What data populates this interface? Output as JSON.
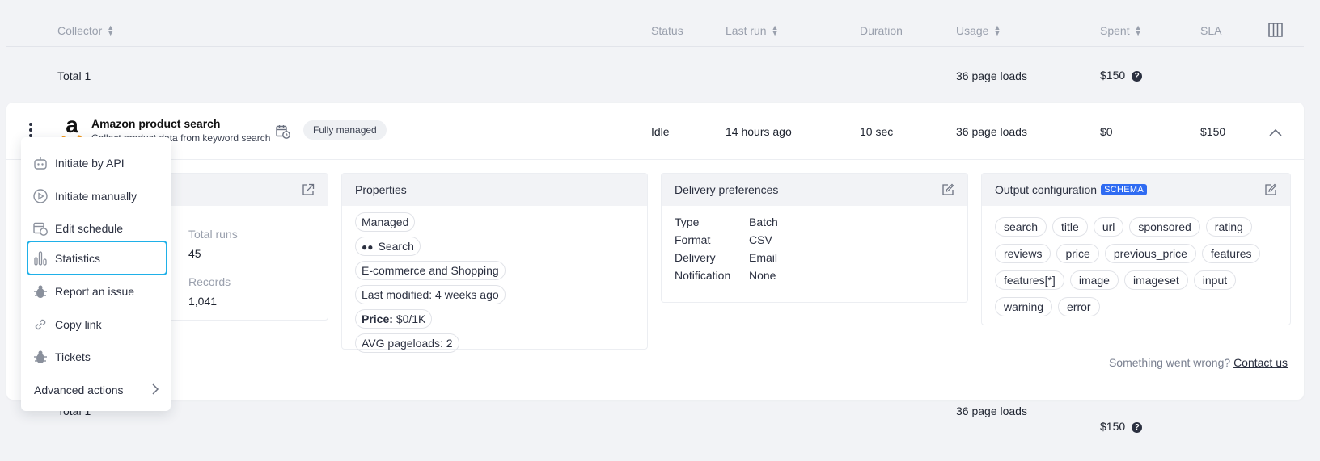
{
  "table": {
    "headers": {
      "collector": "Collector",
      "status": "Status",
      "last_run": "Last run",
      "duration": "Duration",
      "usage": "Usage",
      "spent": "Spent",
      "sla": "SLA"
    },
    "total_row": {
      "label": "Total 1",
      "usage": "36 page loads",
      "spent": "$150"
    }
  },
  "collector": {
    "title": "Amazon product search",
    "subtitle": "Collect product data from keyword search",
    "badge": "Fully managed",
    "status": "Idle",
    "last_run": "14 hours ago",
    "duration": "10 sec",
    "usage": "36 page loads",
    "spent": "$0",
    "sla": "$150"
  },
  "stats_panel": {
    "total_runs_label": "Total runs",
    "total_runs_value": "45",
    "records_label": "Records",
    "records_value": "1,041"
  },
  "properties": {
    "title": "Properties",
    "items": {
      "managed": "Managed",
      "search": "Search",
      "category": "E-commerce and Shopping",
      "last_modified": "Last modified: 4 weeks ago",
      "price_label": "Price:",
      "price_value": "$0/1K",
      "avg": "AVG pageloads: 2"
    }
  },
  "delivery": {
    "title": "Delivery preferences",
    "rows": [
      {
        "k": "Type",
        "v": "Batch"
      },
      {
        "k": "Format",
        "v": "CSV"
      },
      {
        "k": "Delivery",
        "v": "Email"
      },
      {
        "k": "Notification",
        "v": "None"
      }
    ]
  },
  "output": {
    "title": "Output configuration",
    "schema_badge": "SCHEMA",
    "fields": [
      "search",
      "title",
      "url",
      "sponsored",
      "rating",
      "reviews",
      "price",
      "previous_price",
      "features",
      "features[*]",
      "image",
      "imageset",
      "input",
      "warning",
      "error"
    ]
  },
  "help": {
    "text": "Something went wrong?",
    "link": "Contact us"
  },
  "menu": {
    "items": [
      {
        "label": "Initiate by API",
        "icon": "robot-icon"
      },
      {
        "label": "Initiate manually",
        "icon": "play-circle-icon"
      },
      {
        "label": "Edit schedule",
        "icon": "calendar-clock-icon"
      },
      {
        "label": "Statistics",
        "icon": "bar-chart-icon"
      },
      {
        "label": "Report an issue",
        "icon": "bug-icon"
      },
      {
        "label": "Copy link",
        "icon": "link-icon"
      },
      {
        "label": "Tickets",
        "icon": "bug-icon"
      }
    ],
    "advanced": "Advanced actions"
  },
  "bottom_row": {
    "label": "Total 1",
    "usage": "36 page loads",
    "spent": "$150"
  },
  "colors": {
    "accent": "#1fb0e8",
    "schema": "#2f6bf2",
    "muted": "#9aa0ad"
  }
}
